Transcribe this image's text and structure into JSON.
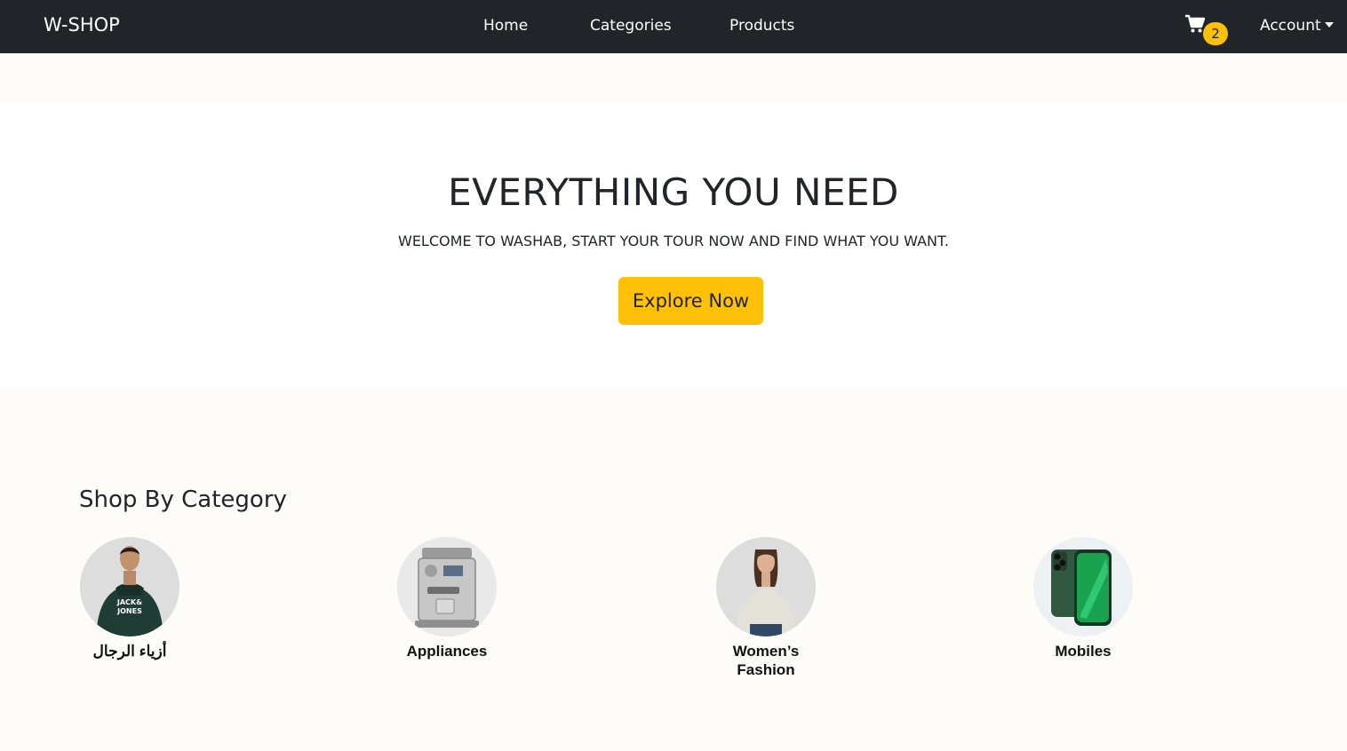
{
  "navbar": {
    "brand": "W-SHOP",
    "links": [
      {
        "label": "Home"
      },
      {
        "label": "Categories"
      },
      {
        "label": "Products"
      }
    ],
    "cart_icon": "cart-icon",
    "cart_count": "2",
    "account_label": "Account"
  },
  "hero": {
    "title": "EVERYTHING YOU NEED",
    "subtitle": "WELCOME TO WASHAB, START YOUR TOUR NOW AND FIND WHAT YOU WANT.",
    "button_label": "Explore Now"
  },
  "categories": {
    "title": "Shop By Category",
    "items": [
      {
        "label": "أزياء الرجال",
        "image": "men-hoodie-photo"
      },
      {
        "label": "Appliances",
        "image": "espresso-machine-photo"
      },
      {
        "label": "Women’s Fashion",
        "image": "women-sweater-photo"
      },
      {
        "label": "Mobiles",
        "image": "green-smartphone-photo"
      }
    ]
  },
  "colors": {
    "navbar_bg": "#212529",
    "accent": "#ffc107",
    "page_bg": "#fdfcf9",
    "hero_bg": "#ffffff"
  }
}
